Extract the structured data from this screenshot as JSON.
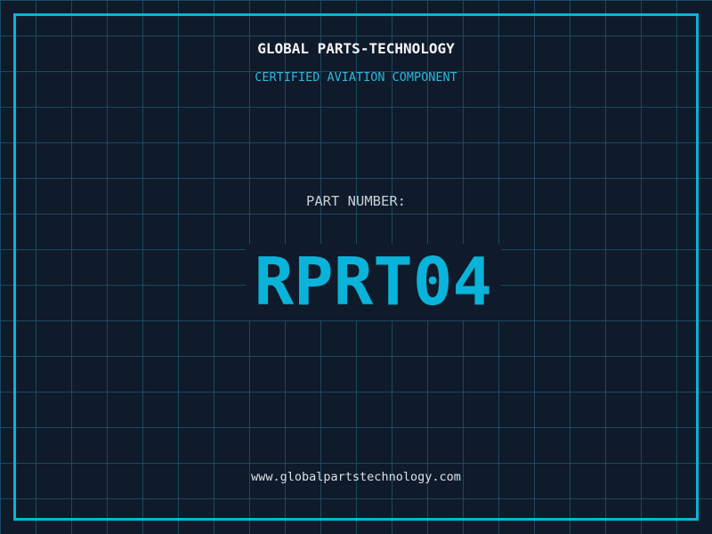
{
  "label": {
    "company": "GLOBAL PARTS-TECHNOLOGY",
    "certification": "CERTIFIED AVIATION COMPONENT",
    "part_number_label": "PART NUMBER:",
    "part_number": "RPRT04",
    "website": "www.globalpartstechnology.com"
  },
  "colors": {
    "background": "#0f1a2b",
    "grid_line": "#1a4a5f",
    "frame_border": "#0ab3d9",
    "certification_text": "#2cb8dc",
    "part_number_text": "#0ab3d9",
    "company_text": "#f2f4f6",
    "label_text": "#c9cfd6",
    "website_text": "#dde1e6"
  },
  "layout_meta": {
    "grid_spacing_px": "40"
  }
}
